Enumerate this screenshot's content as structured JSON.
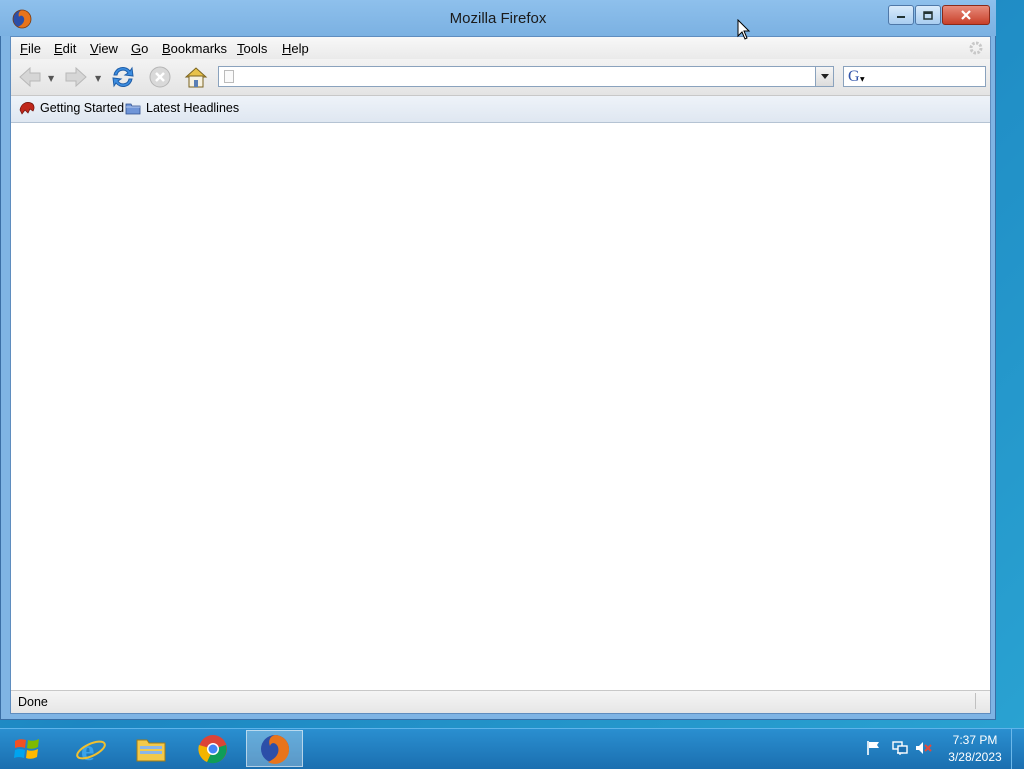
{
  "window": {
    "title": "Mozilla Firefox"
  },
  "menubar": {
    "items": [
      {
        "key": "F",
        "rest": "ile"
      },
      {
        "key": "E",
        "rest": "dit"
      },
      {
        "key": "V",
        "rest": "iew"
      },
      {
        "key": "G",
        "rest": "o"
      },
      {
        "key": "B",
        "rest": "ookmarks"
      },
      {
        "key": "T",
        "rest": "ools"
      },
      {
        "key": "H",
        "rest": "elp"
      }
    ]
  },
  "navbar": {
    "url_value": "",
    "search_value": "",
    "search_engine_icon": "google-g-icon"
  },
  "bookmarks": {
    "items": [
      {
        "label": "Getting Started",
        "icon": "firefox-bookmark-icon"
      },
      {
        "label": "Latest Headlines",
        "icon": "folder-icon"
      }
    ]
  },
  "status": {
    "text": "Done"
  },
  "taskbar": {
    "apps": [
      {
        "name": "internet-explorer"
      },
      {
        "name": "file-explorer"
      },
      {
        "name": "chrome"
      },
      {
        "name": "firefox",
        "active": true
      }
    ],
    "clock": {
      "time": "7:37 PM",
      "date": "3/28/2023"
    }
  },
  "colors": {
    "desktop": "#1d87c2",
    "window_frame": "#7fb4e4",
    "taskbar": "#1b6fb0"
  }
}
